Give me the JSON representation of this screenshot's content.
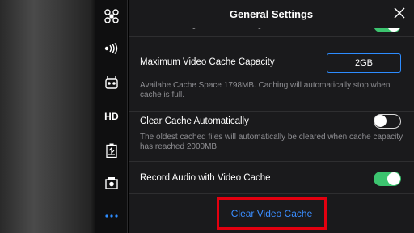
{
  "sidebar": {
    "items": [
      {
        "icon": "drone-icon"
      },
      {
        "icon": "signal-icon"
      },
      {
        "icon": "remote-controller-icon"
      },
      {
        "label": "HD"
      },
      {
        "icon": "battery-icon"
      },
      {
        "icon": "camera-icon"
      },
      {
        "icon": "more-icon"
      }
    ]
  },
  "header": {
    "title": "General Settings"
  },
  "settings": {
    "partial_row_label": "Cache During Video Shooting",
    "partial_row_on": true,
    "max_cache": {
      "label": "Maximum Video Cache Capacity",
      "value": "2GB",
      "description": "Availabe Cache Space 1798MB. Caching will automatically stop when cache is full."
    },
    "clear_auto": {
      "label": "Clear Cache Automatically",
      "on": false,
      "description": "The oldest cached files will automatically be cleared when cache capacity has reached 2000MB"
    },
    "record_audio": {
      "label": "Record Audio with Video Cache",
      "on": true
    }
  },
  "actions": {
    "clear_cache_label": "Clear Video Cache"
  },
  "colors": {
    "accent_blue": "#2d8cff",
    "toggle_green": "#3cc46f",
    "highlight_red": "#e3000f"
  }
}
